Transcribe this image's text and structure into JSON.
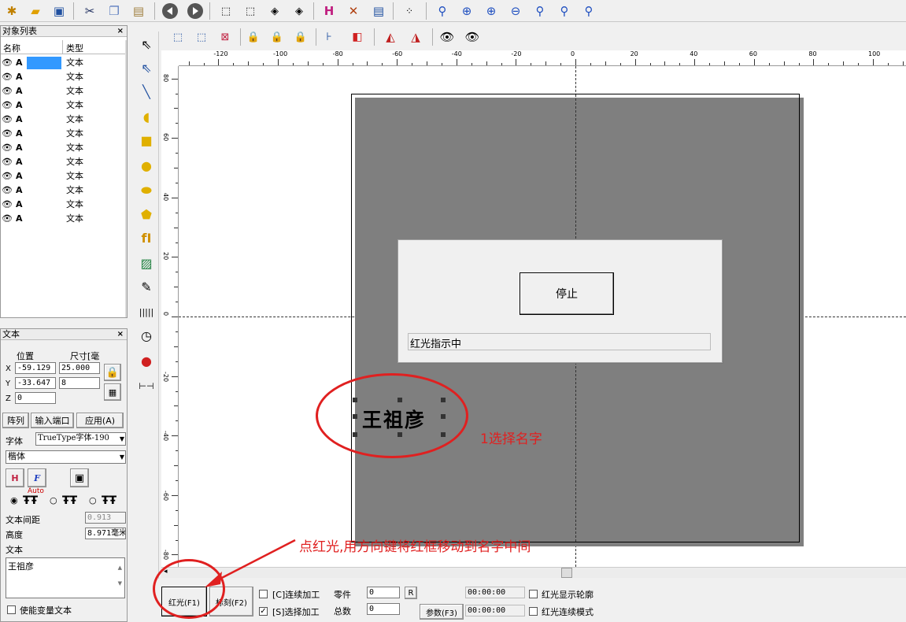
{
  "toolbar_main": {
    "icons": [
      "new-icon",
      "open-icon",
      "save-icon",
      "cut-icon",
      "copy-icon",
      "paste-icon",
      "back-icon",
      "forward-icon",
      "node-edit-icon",
      "node-select-icon",
      "node-add-icon",
      "node-delete-icon",
      "hatch-icon",
      "tools-icon",
      "list-icon",
      "grid-icon",
      "zoom-icon",
      "zoom-in-icon",
      "zoom-in2-icon",
      "zoom-out-icon",
      "zoom-all-icon",
      "zoom-window-icon",
      "zoom-select-icon"
    ]
  },
  "object_list": {
    "title": "对象列表",
    "col_name": "名称",
    "col_type": "类型",
    "rows": [
      {
        "name": "A",
        "type": "文本"
      },
      {
        "name": "A",
        "type": "文本"
      },
      {
        "name": "A",
        "type": "文本"
      },
      {
        "name": "A",
        "type": "文本"
      },
      {
        "name": "A",
        "type": "文本"
      },
      {
        "name": "A",
        "type": "文本"
      },
      {
        "name": "A",
        "type": "文本"
      },
      {
        "name": "A",
        "type": "文本"
      },
      {
        "name": "A",
        "type": "文本"
      },
      {
        "name": "A",
        "type": "文本"
      },
      {
        "name": "A",
        "type": "文本"
      },
      {
        "name": "A",
        "type": "文本"
      }
    ]
  },
  "text_panel": {
    "title": "文本",
    "pos_label": "位置",
    "size_label": "尺寸[毫",
    "x_label": "X",
    "y_label": "Y",
    "z_label": "Z",
    "x_val": "-59.129",
    "y_val": "-33.647",
    "z_val": "0",
    "w_val": "25.000",
    "h_val": "8",
    "array_btn": "阵列",
    "input_port_btn": "输入端口",
    "apply_btn": "应用(A)",
    "font_label": "字体",
    "font_type": "TrueType字体-190",
    "font_name": "楷体",
    "auto_label": "Auto",
    "spacing_label": "文本间距",
    "spacing_val": "0.913",
    "height_label": "高度",
    "height_val": "8.971毫米",
    "text_label": "文本",
    "text_val": "王祖彦",
    "variable_label": "使能变量文本"
  },
  "ruler": {
    "h_ticks": [
      "-120",
      "-100",
      "-80",
      "-60",
      "-40",
      "-20",
      "0",
      "20",
      "40",
      "60",
      "80",
      "100"
    ],
    "v_ticks": [
      "80",
      "60",
      "40",
      "20",
      "0",
      "-20",
      "-40",
      "-60",
      "-80"
    ]
  },
  "canvas": {
    "name_text": "王祖彦"
  },
  "dialog": {
    "stop_btn": "停止",
    "status": "红光指示中"
  },
  "annotations": {
    "step1": "1选择名字",
    "step2": "点红光,用方向键将红框移动到名字中间",
    "color": "#e02020"
  },
  "bottom": {
    "red_btn": "红光(F1)",
    "mark_btn": "标刻(F2)",
    "continuous": "[C]连续加工",
    "select_proc": "[S]选择加工",
    "parts_label": "零件",
    "total_label": "总数",
    "parts_val": "0",
    "total_val": "0",
    "r_btn": "R",
    "params_btn": "参数(F3)",
    "time1": "00:00:00",
    "time2": "00:00:00",
    "show_outline": "红光显示轮廓",
    "continuous_mode": "红光连续模式"
  }
}
